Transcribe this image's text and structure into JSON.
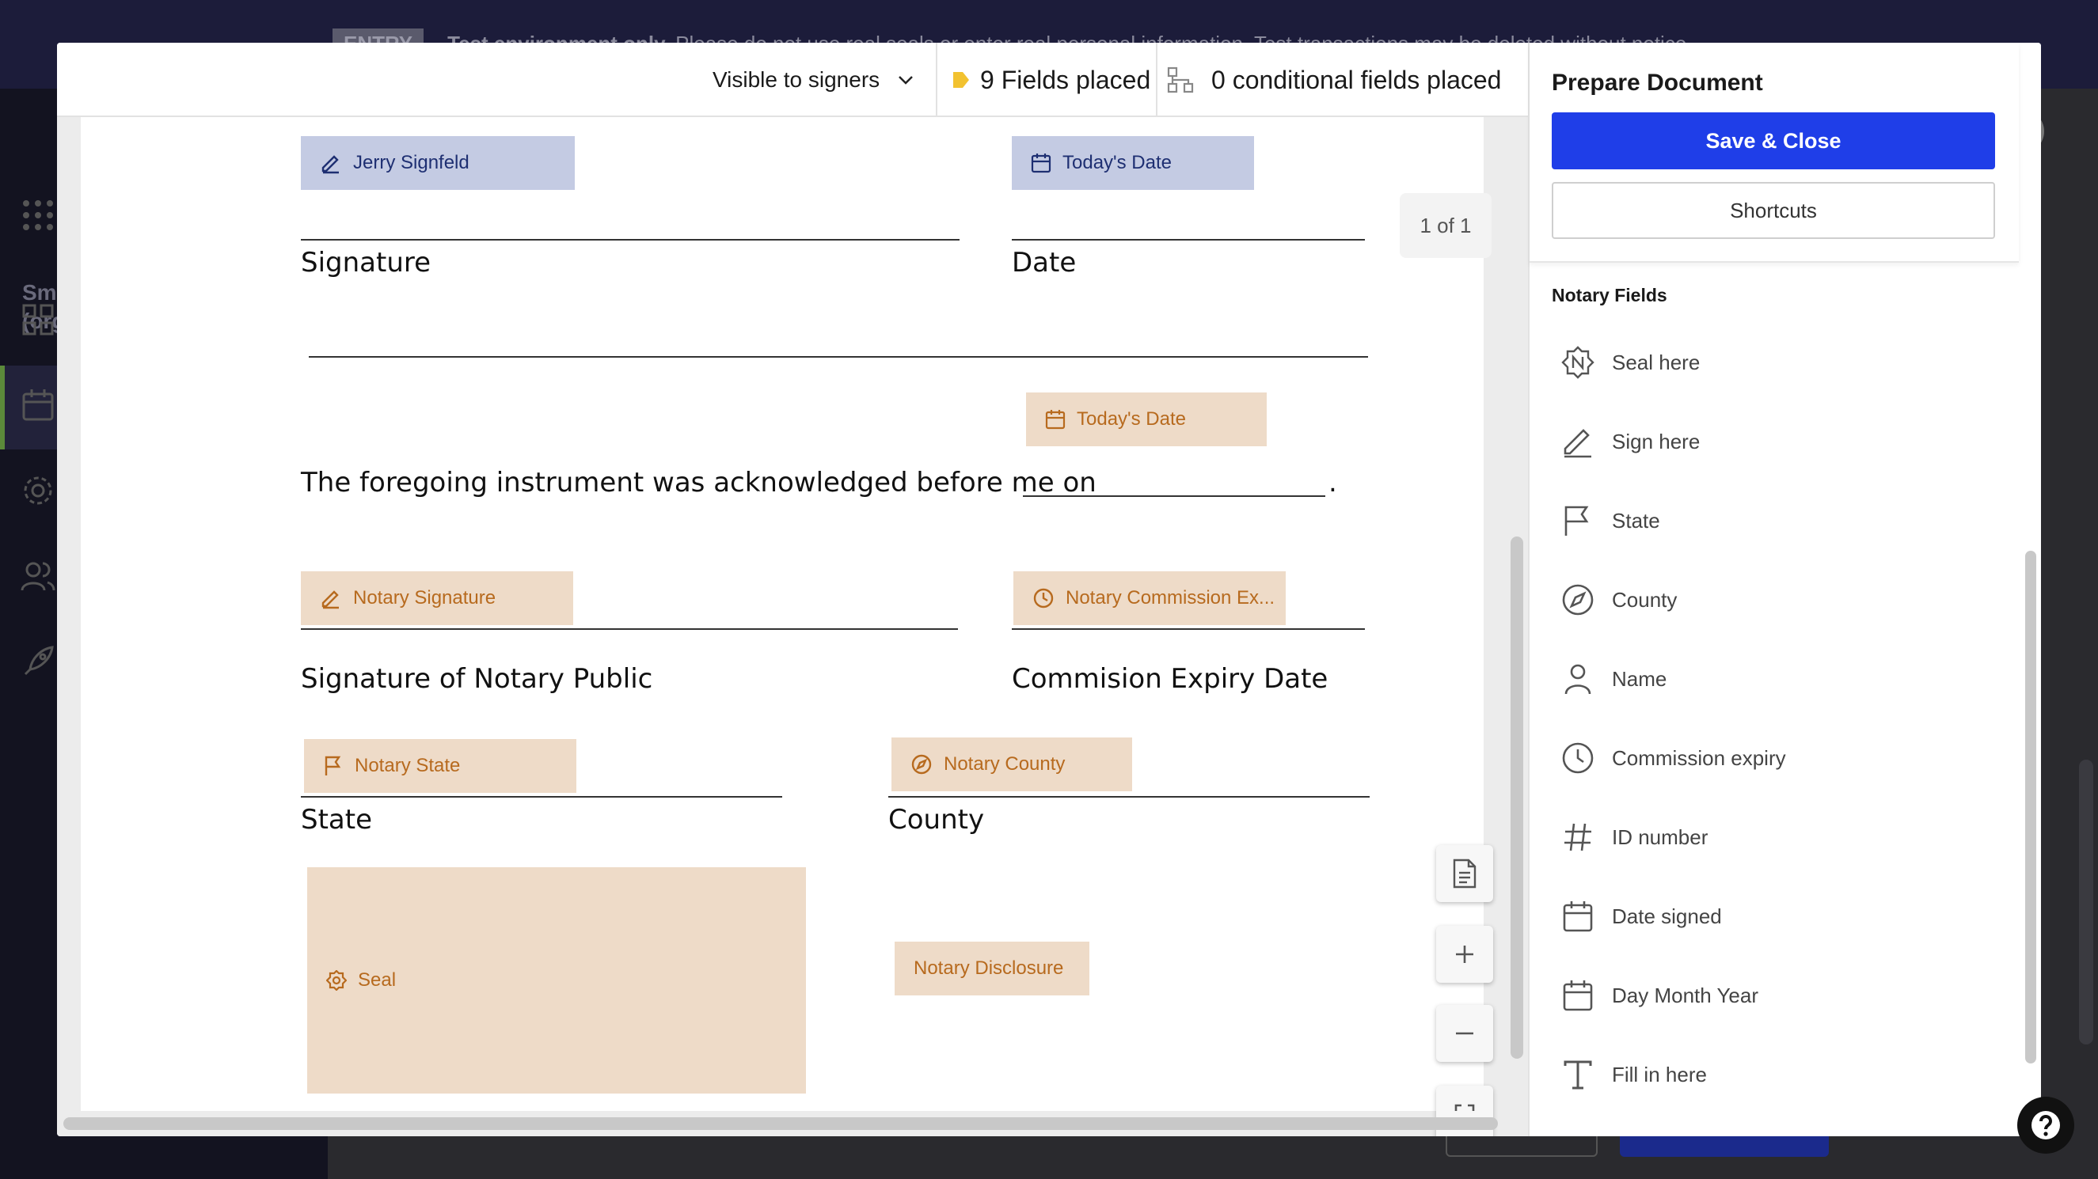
{
  "background": {
    "banner_tag": "ENTRY",
    "banner_bold": "Test environment only.",
    "banner_text": "Please do not use real seals or enter real personal information. Test transactions may be deleted without notice.",
    "org_name_line1": "Smi",
    "org_name_line2": "(org"
  },
  "toolbar": {
    "visibility_label": "Visible to signers",
    "fields_placed": "9 Fields placed",
    "conditional_placed": "0 conditional fields placed"
  },
  "document": {
    "page_indicator": "1 of 1",
    "labels": {
      "signature": "Signature",
      "date": "Date",
      "acknowledged": "The foregoing instrument was acknowledged before me on",
      "period": ".",
      "signature_notary": "Signature of Notary Public",
      "commission_expiry": "Commision Expiry Date",
      "state": "State",
      "county": "County"
    },
    "fields": {
      "signer": "Jerry Signfeld",
      "date_top": "Today's Date",
      "date_ack": "Today's Date",
      "notary_signature": "Notary Signature",
      "notary_commission": "Notary Commission Ex...",
      "notary_state": "Notary State",
      "notary_county": "Notary County",
      "seal": "Seal",
      "notary_disclosure": "Notary Disclosure"
    }
  },
  "panel": {
    "title": "Prepare Document",
    "save_label": "Save & Close",
    "shortcuts_label": "Shortcuts",
    "section_title": "Notary Fields",
    "items": [
      {
        "label": "Seal here",
        "icon": "seal-icon"
      },
      {
        "label": "Sign here",
        "icon": "pen-icon"
      },
      {
        "label": "State",
        "icon": "flag-icon"
      },
      {
        "label": "County",
        "icon": "compass-icon"
      },
      {
        "label": "Name",
        "icon": "person-icon"
      },
      {
        "label": "Commission expiry",
        "icon": "clock-icon"
      },
      {
        "label": "ID number",
        "icon": "hash-icon"
      },
      {
        "label": "Date signed",
        "icon": "calendar-icon"
      },
      {
        "label": "Day Month Year",
        "icon": "calendar-icon"
      },
      {
        "label": "Fill in here",
        "icon": "text-icon"
      }
    ]
  },
  "colors": {
    "primary": "#1f3ee8",
    "field_blue_bg": "#c4cbe3",
    "field_blue_text": "#1e2f72",
    "field_orange_bg": "#eedbc8",
    "field_orange_text": "#b76a1e",
    "fields_tag": "#f2c230"
  }
}
